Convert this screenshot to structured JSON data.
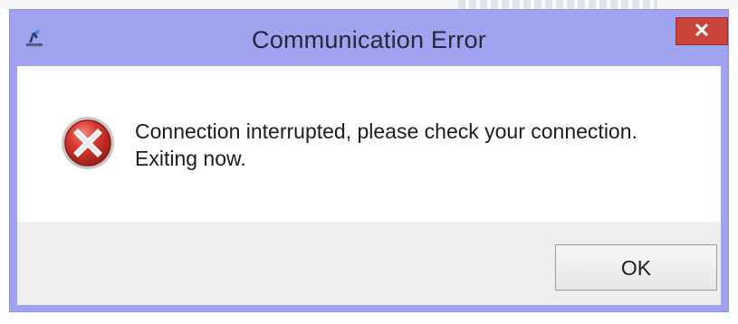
{
  "dialog": {
    "title": "Communication Error",
    "close_label": "✕",
    "message": "Connection interrupted, please check your connection.\nExiting now.",
    "ok_label": "OK"
  },
  "icons": {
    "app": "app-icon",
    "error": "error-x-icon",
    "close": "close-icon"
  },
  "colors": {
    "titlebar": "#9fa3f0",
    "close_button": "#c9443b",
    "content_background": "#ffffff",
    "button_area": "#eeeeee"
  }
}
